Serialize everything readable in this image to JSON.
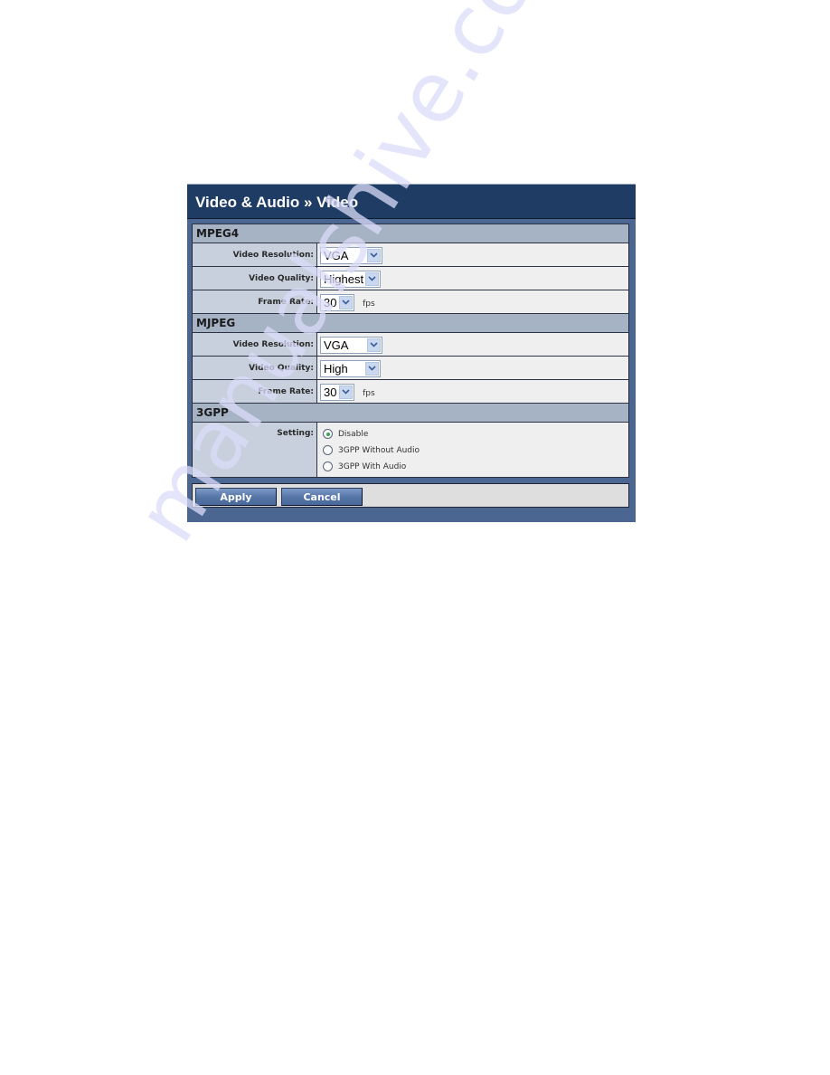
{
  "header": {
    "title": "Video & Audio » Video"
  },
  "sections": {
    "mpeg4": {
      "title": "MPEG4",
      "video_resolution": {
        "label": "Video Resolution:",
        "value": "VGA"
      },
      "video_quality": {
        "label": "Video Quality:",
        "value": "Highest"
      },
      "frame_rate": {
        "label": "Frame Rate:",
        "value": "30",
        "unit": "fps"
      }
    },
    "mjpeg": {
      "title": "MJPEG",
      "video_resolution": {
        "label": "Video Resolution:",
        "value": "VGA"
      },
      "video_quality": {
        "label": "Video Quality:",
        "value": "High"
      },
      "frame_rate": {
        "label": "Frame Rate:",
        "value": "30",
        "unit": "fps"
      }
    },
    "gpp3": {
      "title": "3GPP",
      "setting": {
        "label": "Setting:",
        "options": [
          {
            "label": "Disable",
            "selected": true
          },
          {
            "label": "3GPP Without Audio",
            "selected": false
          },
          {
            "label": "3GPP With Audio",
            "selected": false
          }
        ]
      }
    }
  },
  "buttons": {
    "apply": "Apply",
    "cancel": "Cancel"
  },
  "watermark": "manualshive.com",
  "colors": {
    "header_bg": "#1f3d64",
    "panel_bg": "#4b6690",
    "section_bg": "#a6b3c5",
    "label_bg": "#c7d0dc",
    "radio_selected": "#3aa35b"
  }
}
